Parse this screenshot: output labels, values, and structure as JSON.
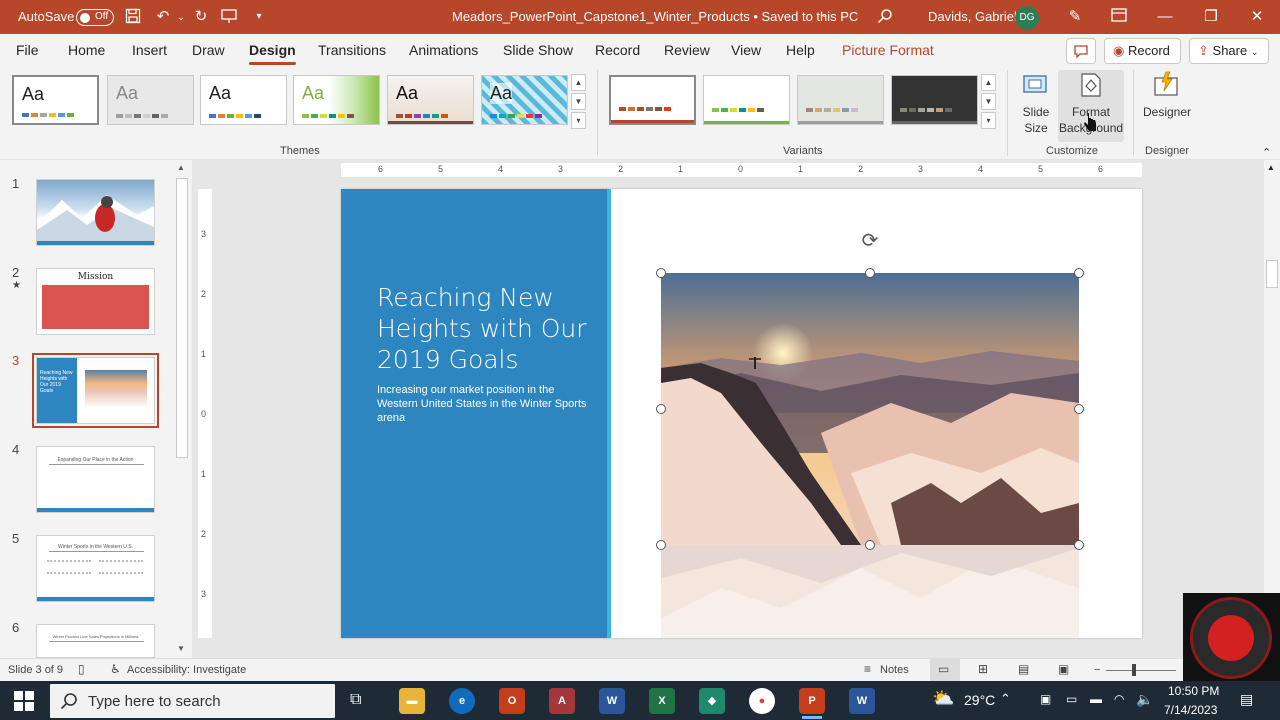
{
  "titlebar": {
    "autosave_label": "AutoSave",
    "autosave_state": "Off",
    "document_title": "Meadors_PowerPoint_Capstone1_Winter_Products • Saved to this PC",
    "user_name": "Davids, Gabriel",
    "user_initials": "DG"
  },
  "menu": {
    "tabs": [
      "File",
      "Home",
      "Insert",
      "Draw",
      "Design",
      "Transitions",
      "Animations",
      "Slide Show",
      "Record",
      "Review",
      "View",
      "Help",
      "Picture Format"
    ],
    "active_tab": "Design",
    "record_button": "Record",
    "share_button": "Share"
  },
  "ribbon": {
    "themes_label": "Themes",
    "variants_label": "Variants",
    "customize_label": "Customize",
    "designer_group_label": "Designer",
    "theme_sample": "Aa",
    "slide_size_label": "Slide Size",
    "format_background_label": "Format Background",
    "designer_label": "Designer"
  },
  "thumbnails": [
    {
      "num": "1",
      "caption": ""
    },
    {
      "num": "2",
      "caption": "Mission"
    },
    {
      "num": "3",
      "caption": "Reaching New Heights with Our 2019 Goals"
    },
    {
      "num": "4",
      "caption": "Expanding Our Place in the Action"
    },
    {
      "num": "5",
      "caption": "Winter Sports in the Western U.S."
    },
    {
      "num": "6",
      "caption": "Winter Product Line Sales Projections in Millions"
    }
  ],
  "slide": {
    "title": "Reaching New Heights with Our 2019 Goals",
    "subtitle": "Increasing our market position in the Western United States in the Winter Sports arena"
  },
  "ruler": {
    "h_ticks": [
      "6",
      "5",
      "4",
      "3",
      "2",
      "1",
      "0",
      "1",
      "2",
      "3",
      "4",
      "5",
      "6"
    ],
    "v_ticks": [
      "3",
      "2",
      "1",
      "0",
      "1",
      "2",
      "3"
    ]
  },
  "status": {
    "slide_info": "Slide 3 of 9",
    "accessibility": "Accessibility: Investigate",
    "notes": "Notes"
  },
  "taskbar": {
    "search_placeholder": "Type here to search",
    "temperature": "29°C",
    "time": "10:50 PM",
    "date": "7/14/2023"
  },
  "colors": {
    "accent": "#b7472a",
    "slide_panel": "#2e86c1"
  }
}
